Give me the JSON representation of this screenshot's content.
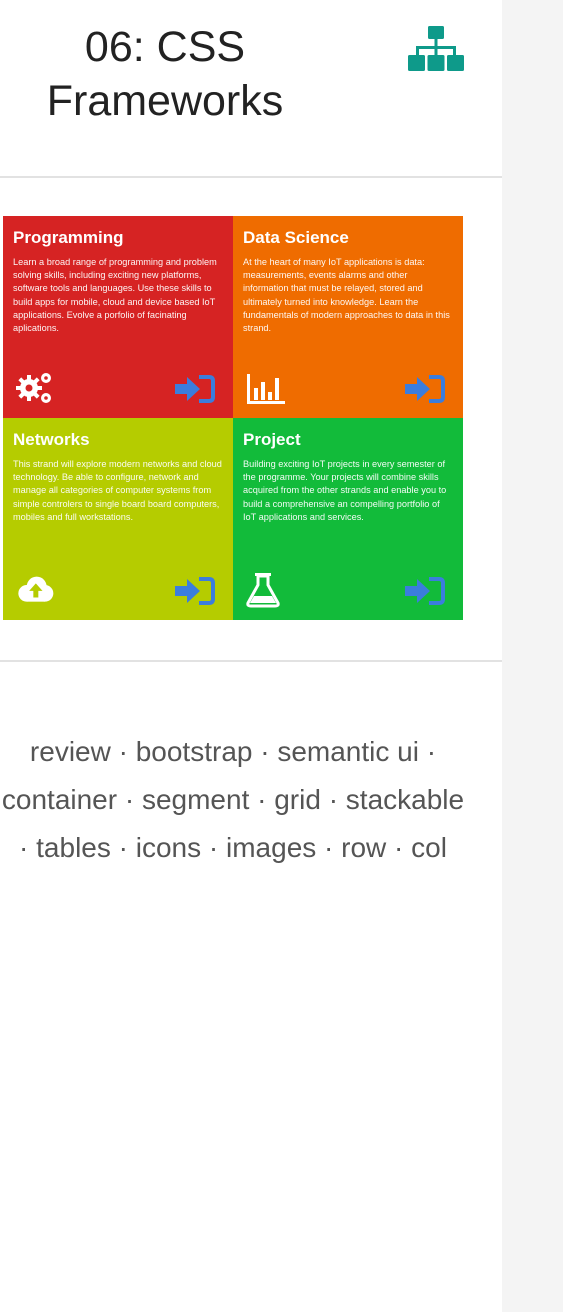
{
  "header": {
    "title_line1": "06: CSS",
    "title_line2": "Frameworks",
    "tree_icon": "sitemap-icon"
  },
  "colors": {
    "accent_teal": "#0e9a8a",
    "programming": "#d62323",
    "data_science": "#ef6c00",
    "networks": "#b5cc00",
    "project": "#12bb3a",
    "arrow_blue": "#3b7ddd"
  },
  "tiles": [
    {
      "title": "Programming",
      "text": "Learn a broad range of programming and problem solving skills, including exciting new platforms, software tools and languages. Use these skills to build apps for mobile, cloud and device based IoT applications. Evolve a porfolio of facinating aplications.",
      "icon": "gears-icon"
    },
    {
      "title": "Data Science",
      "text": "At the heart of many IoT applications is data: measurements, events alarms and other information that must be relayed, stored and ultimately turned into knowledge. Learn the fundamentals of modern approaches to data in this strand.",
      "icon": "bar-chart-icon"
    },
    {
      "title": "Networks",
      "text": "This strand will explore modern networks and cloud technology. Be able to configure, network and manage all categories of computer systems from simple controlers to single board board computers, mobiles and full workstations.",
      "icon": "cloud-upload-icon"
    },
    {
      "title": "Project",
      "text": "Building exciting IoT projects in every semester of the programme. Your projects will combine skills acquired from the other strands and enable you to build a comprehensive an compelling portfolio of IoT applications and services.",
      "icon": "flask-icon"
    }
  ],
  "tags": {
    "text": "review · bootstrap · semantic ui · container · segment · grid · stackable · tables · icons · images · row · col"
  }
}
